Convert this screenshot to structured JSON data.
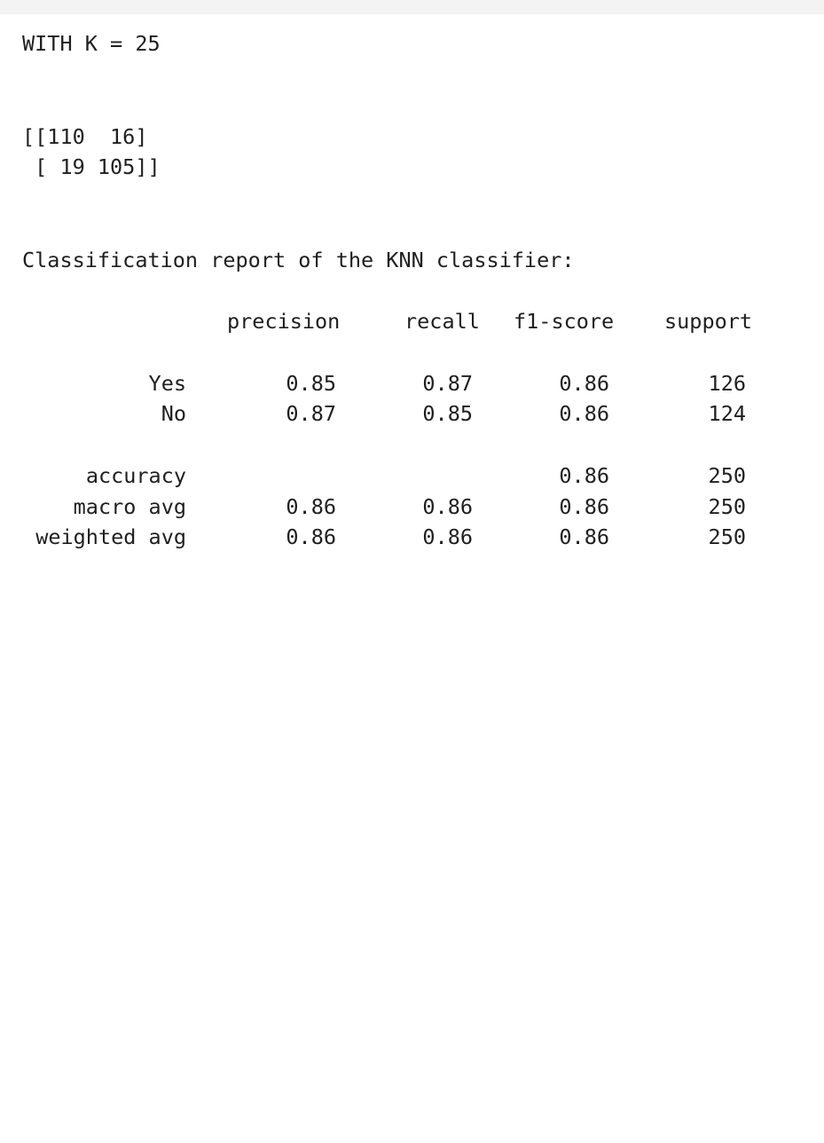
{
  "heading": "WITH K = 25",
  "confusion_matrix": {
    "row1": "[[110  16]",
    "row2": " [ 19 105]]"
  },
  "report_title": "Classification report of the KNN classifier:",
  "report": {
    "headers": [
      "precision",
      "recall",
      "f1-score",
      "support"
    ],
    "rows": [
      {
        "label": "Yes",
        "precision": "0.85",
        "recall": "0.87",
        "f1": "0.86",
        "support": "126"
      },
      {
        "label": "No",
        "precision": "0.87",
        "recall": "0.85",
        "f1": "0.86",
        "support": "124"
      },
      {
        "label": "accuracy",
        "precision": "",
        "recall": "",
        "f1": "0.86",
        "support": "250"
      },
      {
        "label": "macro avg",
        "precision": "0.86",
        "recall": "0.86",
        "f1": "0.86",
        "support": "250"
      },
      {
        "label": "weighted avg",
        "precision": "0.86",
        "recall": "0.86",
        "f1": "0.86",
        "support": "250"
      }
    ]
  }
}
